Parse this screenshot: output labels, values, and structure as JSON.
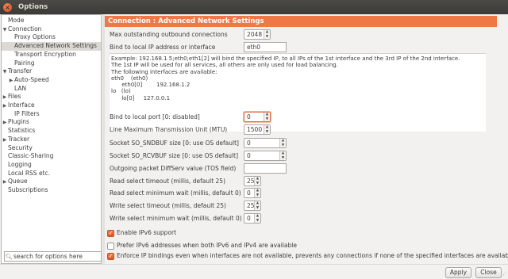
{
  "window": {
    "title": "Options"
  },
  "sidebar": {
    "items": [
      {
        "label": "Mode",
        "arrow": ""
      },
      {
        "label": "Connection",
        "arrow": "▼"
      },
      {
        "label": "Proxy Options",
        "arrow": ""
      },
      {
        "label": "Advanced Network Settings",
        "arrow": ""
      },
      {
        "label": "Transport Encryption",
        "arrow": ""
      },
      {
        "label": "Pairing",
        "arrow": ""
      },
      {
        "label": "Transfer",
        "arrow": "▼"
      },
      {
        "label": "Auto-Speed",
        "arrow": "▶"
      },
      {
        "label": "LAN",
        "arrow": ""
      },
      {
        "label": "Files",
        "arrow": "▶"
      },
      {
        "label": "Interface",
        "arrow": "▶"
      },
      {
        "label": "IP Filters",
        "arrow": ""
      },
      {
        "label": "Plugins",
        "arrow": "▶"
      },
      {
        "label": "Statistics",
        "arrow": ""
      },
      {
        "label": "Tracker",
        "arrow": "▶"
      },
      {
        "label": "Security",
        "arrow": ""
      },
      {
        "label": "Classic-Sharing",
        "arrow": ""
      },
      {
        "label": "Logging",
        "arrow": ""
      },
      {
        "label": "Local RSS etc.",
        "arrow": ""
      },
      {
        "label": "Queue",
        "arrow": "▶"
      },
      {
        "label": "Subscriptions",
        "arrow": ""
      }
    ],
    "selected_index": 3,
    "search": {
      "value": "",
      "placeholder": "search for options here",
      "icon": "search-icon"
    }
  },
  "content": {
    "header": "Connection : Advanced Network Settings",
    "max_outbound": {
      "label": "Max outstanding outbound connections",
      "value": "2048"
    },
    "bind_ip": {
      "label": "Bind to local IP address or interface",
      "value": "eth0"
    },
    "info_text": "Example: 192.168.1.5;eth0;eth1[2] will bind the specified IP, to all IPs of the 1st interface and the 3rd IP of the 2nd interface.\nThe 1st IP will be used for all services, all others are only used for load balancing.\nThe following interfaces are available:\neth0    (eth0)\n      eth0[0]        192.168.1.2\nlo   (lo)\n      lo[0]     127.0.0.1",
    "bind_port": {
      "label": "Bind to local port [0: disabled]",
      "value": "0"
    },
    "mtu": {
      "label": "Line Maximum Transmission Unit (MTU)",
      "value": "1500"
    },
    "sndbuf": {
      "label": "Socket SO_SNDBUF size [0: use OS default]",
      "value": "0"
    },
    "rcvbuf": {
      "label": "Socket SO_RCVBUF size [0: use OS default]",
      "value": "0"
    },
    "tos": {
      "label": "Outgoing packet DiffServ value (TOS field)",
      "value": ""
    },
    "read_timeout": {
      "label": "Read select timeout (millis, default 25)",
      "value": "25"
    },
    "read_min_wait": {
      "label": "Read select minimum wait (millis, default 0)",
      "value": "0"
    },
    "write_timeout": {
      "label": "Write select timeout (millis, default 25)",
      "value": "25"
    },
    "write_min_wait": {
      "label": "Write select minimum wait (millis, default 0)",
      "value": "0"
    },
    "enable_ipv6": {
      "label": "Enable IPv6 support",
      "checked": true
    },
    "prefer_ipv6": {
      "label": "Prefer IPv6 addresses when both IPv6 and IPv4 are available",
      "checked": false
    },
    "enforce_bindings": {
      "label": "Enforce IP bindings even when interfaces are not available, prevents any connections if none of the specified interfaces are available",
      "checked": true
    }
  },
  "buttons": {
    "apply": "Apply",
    "close": "Close"
  },
  "colors": {
    "accent": "#f07746",
    "titlebar": "#3c3b37"
  }
}
